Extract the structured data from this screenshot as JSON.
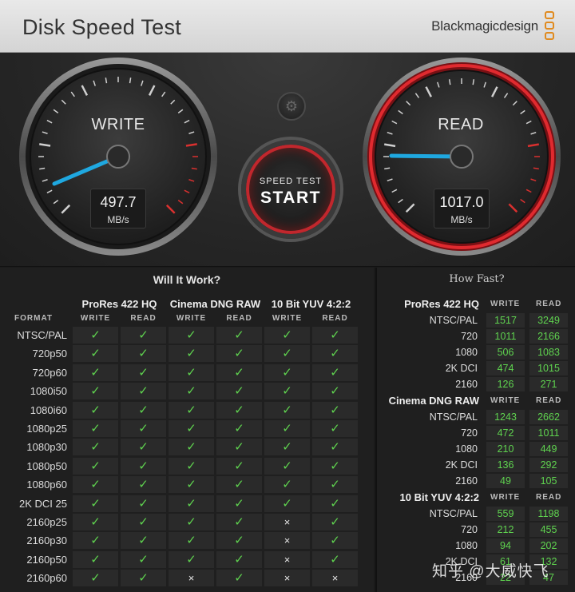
{
  "app": {
    "title": "Disk Speed Test",
    "brand": "Blackmagicdesign"
  },
  "colors": {
    "accent_red": "#c1272d",
    "needle_blue": "#1fa8e0",
    "check_green": "#5fd34f",
    "brand_orange": "#e08a1e"
  },
  "gauges": {
    "write": {
      "label": "WRITE",
      "value": "497.7",
      "unit": "MB/s"
    },
    "read": {
      "label": "READ",
      "value": "1017.0",
      "unit": "MB/s"
    }
  },
  "start_button": {
    "line1": "SPEED TEST",
    "line2": "START"
  },
  "settings_icon": "gear-icon",
  "will": {
    "title": "Will It Work?",
    "format_header": "FORMAT",
    "groups": [
      "ProRes 422 HQ",
      "Cinema DNG RAW",
      "10 Bit YUV 4:2:2"
    ],
    "write_label": "WRITE",
    "read_label": "READ",
    "check_glyph": "✓",
    "cross_glyph": "×",
    "rows": [
      {
        "format": "NTSC/PAL",
        "cells": [
          1,
          1,
          1,
          1,
          1,
          1
        ]
      },
      {
        "format": "720p50",
        "cells": [
          1,
          1,
          1,
          1,
          1,
          1
        ]
      },
      {
        "format": "720p60",
        "cells": [
          1,
          1,
          1,
          1,
          1,
          1
        ]
      },
      {
        "format": "1080i50",
        "cells": [
          1,
          1,
          1,
          1,
          1,
          1
        ]
      },
      {
        "format": "1080i60",
        "cells": [
          1,
          1,
          1,
          1,
          1,
          1
        ]
      },
      {
        "format": "1080p25",
        "cells": [
          1,
          1,
          1,
          1,
          1,
          1
        ]
      },
      {
        "format": "1080p30",
        "cells": [
          1,
          1,
          1,
          1,
          1,
          1
        ]
      },
      {
        "format": "1080p50",
        "cells": [
          1,
          1,
          1,
          1,
          1,
          1
        ]
      },
      {
        "format": "1080p60",
        "cells": [
          1,
          1,
          1,
          1,
          1,
          1
        ]
      },
      {
        "format": "2K DCI 25",
        "cells": [
          1,
          1,
          1,
          1,
          1,
          1
        ]
      },
      {
        "format": "2160p25",
        "cells": [
          1,
          1,
          1,
          1,
          0,
          1
        ]
      },
      {
        "format": "2160p30",
        "cells": [
          1,
          1,
          1,
          1,
          0,
          1
        ]
      },
      {
        "format": "2160p50",
        "cells": [
          1,
          1,
          1,
          1,
          0,
          1
        ]
      },
      {
        "format": "2160p60",
        "cells": [
          1,
          1,
          0,
          1,
          0,
          0
        ]
      }
    ]
  },
  "how": {
    "title": "How Fast?",
    "write_label": "WRITE",
    "read_label": "READ",
    "sections": [
      {
        "name": "ProRes 422 HQ",
        "rows": [
          {
            "format": "NTSC/PAL",
            "write": "1517",
            "read": "3249"
          },
          {
            "format": "720",
            "write": "1011",
            "read": "2166"
          },
          {
            "format": "1080",
            "write": "506",
            "read": "1083"
          },
          {
            "format": "2K DCI",
            "write": "474",
            "read": "1015"
          },
          {
            "format": "2160",
            "write": "126",
            "read": "271"
          }
        ]
      },
      {
        "name": "Cinema DNG RAW",
        "rows": [
          {
            "format": "NTSC/PAL",
            "write": "1243",
            "read": "2662"
          },
          {
            "format": "720",
            "write": "472",
            "read": "1011"
          },
          {
            "format": "1080",
            "write": "210",
            "read": "449"
          },
          {
            "format": "2K DCI",
            "write": "136",
            "read": "292"
          },
          {
            "format": "2160",
            "write": "49",
            "read": "105"
          }
        ]
      },
      {
        "name": "10 Bit YUV 4:2:2",
        "rows": [
          {
            "format": "NTSC/PAL",
            "write": "559",
            "read": "1198"
          },
          {
            "format": "720",
            "write": "212",
            "read": "455"
          },
          {
            "format": "1080",
            "write": "94",
            "read": "202"
          },
          {
            "format": "2K DCI",
            "write": "61",
            "read": "132"
          },
          {
            "format": "2160",
            "write": "22",
            "read": "47"
          }
        ]
      }
    ]
  },
  "watermark": "知乎 @大威快飞"
}
